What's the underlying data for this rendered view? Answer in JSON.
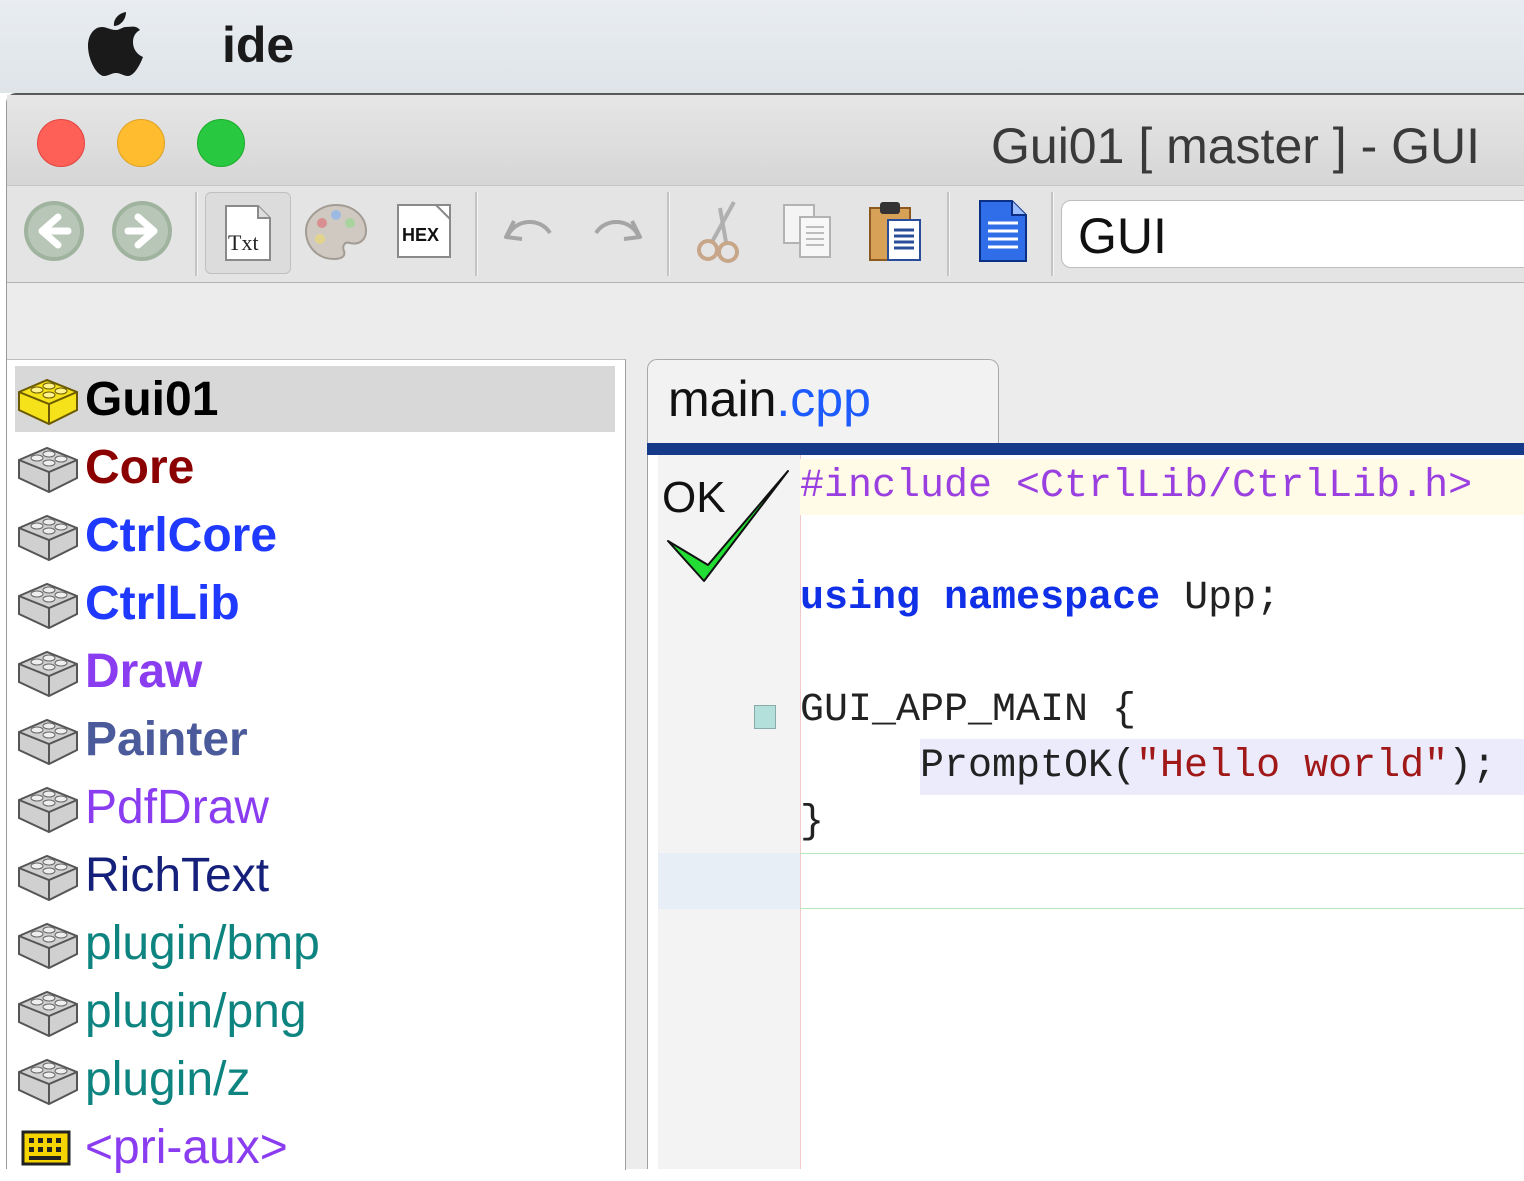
{
  "menubar": {
    "app_name": "ide"
  },
  "window": {
    "title": "Gui01 [ master ]  - GUI"
  },
  "toolbar": {
    "buttons": [
      "back-icon",
      "forward-icon",
      "txt-view-icon",
      "palette-icon",
      "hex-view-icon",
      "undo-icon",
      "redo-icon",
      "cut-icon",
      "copy-icon",
      "paste-icon",
      "document-icon"
    ],
    "txt_label": "Txt",
    "hex_label": "HEX",
    "build_config": "GUI"
  },
  "packages": [
    {
      "name": "Gui01",
      "color": "#000000",
      "selected": true,
      "icon": "package-yellow-icon"
    },
    {
      "name": "Core",
      "color": "#8b0000",
      "icon": "package-icon"
    },
    {
      "name": "CtrlCore",
      "color": "#1f39ff",
      "icon": "package-icon"
    },
    {
      "name": "CtrlLib",
      "color": "#1f39ff",
      "icon": "package-icon"
    },
    {
      "name": "Draw",
      "color": "#8a3cf0",
      "icon": "package-icon"
    },
    {
      "name": "Painter",
      "color": "#4a5a9a",
      "icon": "package-icon"
    },
    {
      "name": "PdfDraw",
      "color": "#8a3cf0",
      "icon": "package-icon"
    },
    {
      "name": "RichText",
      "color": "#15207a",
      "icon": "package-icon"
    },
    {
      "name": "plugin/bmp",
      "color": "#0e8480",
      "icon": "package-icon"
    },
    {
      "name": "plugin/png",
      "color": "#0e8480",
      "icon": "package-icon"
    },
    {
      "name": "plugin/z",
      "color": "#0e8480",
      "icon": "package-icon"
    },
    {
      "name": "<pri-aux>",
      "color": "#8a3cf0",
      "icon": "aux-icon"
    }
  ],
  "editor": {
    "tab_name": "main",
    "tab_ext": ".cpp",
    "status_label": "OK",
    "code": {
      "l1_directive": "#include",
      "l1_header": " <CtrlLib/CtrlLib.h>",
      "l3_kw1": "using",
      "l3_kw2": "namespace",
      "l3_rest": " Upp;",
      "l5": "GUI_APP_MAIN {",
      "l6_call": "PromptOK(",
      "l6_str": "\"Hello world\"",
      "l6_end": ");",
      "l7": "}"
    }
  }
}
